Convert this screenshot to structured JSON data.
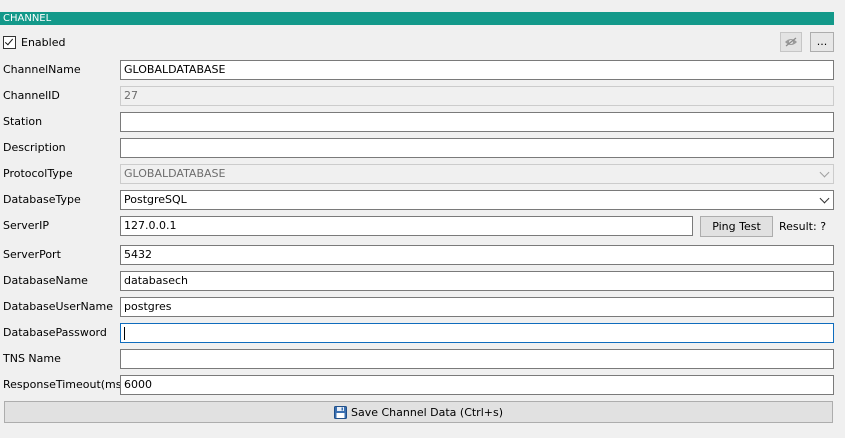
{
  "header": {
    "title": "CHANNEL"
  },
  "enabled": {
    "label": "Enabled",
    "checked": true
  },
  "toolbar": {
    "more_label": "..."
  },
  "fields": {
    "channel_name": {
      "label": "ChannelName",
      "value": "GLOBALDATABASE"
    },
    "channel_id": {
      "label": "ChannelID",
      "value": "27"
    },
    "station": {
      "label": "Station",
      "value": ""
    },
    "description": {
      "label": "Description",
      "value": ""
    },
    "protocol_type": {
      "label": "ProtocolType",
      "value": "GLOBALDATABASE"
    },
    "database_type": {
      "label": "DatabaseType",
      "value": "PostgreSQL"
    },
    "server_ip": {
      "label": "ServerIP",
      "value": "127.0.0.1"
    },
    "server_port": {
      "label": "ServerPort",
      "value": "5432"
    },
    "database_name": {
      "label": "DatabaseName",
      "value": "databasech"
    },
    "database_user_name": {
      "label": "DatabaseUserName",
      "value": "postgres"
    },
    "database_password": {
      "label": "DatabasePassword",
      "value": ""
    },
    "tns_name": {
      "label": "TNS Name",
      "value": ""
    },
    "response_timeout": {
      "label": "ResponseTimeout(ms)",
      "value": "6000"
    }
  },
  "ping": {
    "button_label": "Ping Test",
    "result_text": "Result: ?"
  },
  "save": {
    "label": "Save Channel Data (Ctrl+s)"
  },
  "colors": {
    "header_bg": "#13998a",
    "focus_border": "#0f6cbd"
  },
  "icons": {
    "eye_button": "eye-icon",
    "save": "floppy-disk-icon"
  }
}
